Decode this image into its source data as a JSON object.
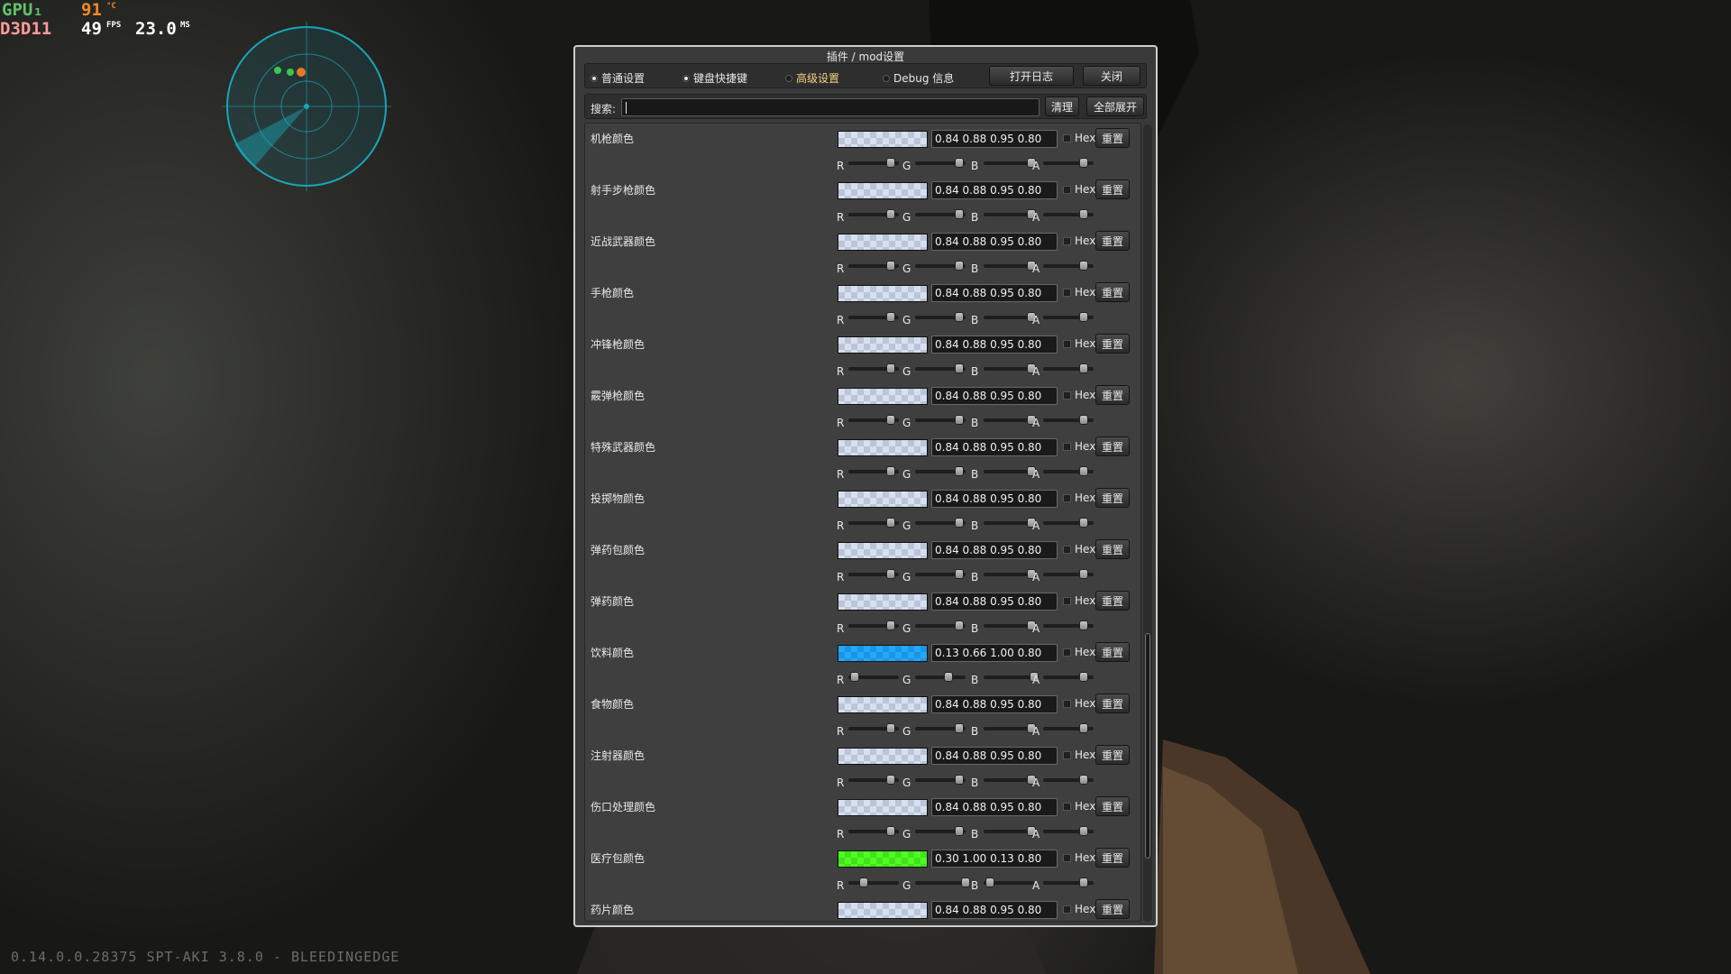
{
  "hud": {
    "gpu_label": "GPU₁",
    "gpu_temp": "91",
    "gpu_temp_unit": "°C",
    "api": "D3D11",
    "fps": "49",
    "fps_unit": "FPS",
    "frametime": "23.0",
    "frametime_unit": "MS"
  },
  "version": "0.14.0.0.28375 SPT-AKI 3.8.0 - BLEEDINGEDGE",
  "window": {
    "title": "插件 / mod设置",
    "tabs": [
      {
        "label": "普通设置",
        "selected": true
      },
      {
        "label": "键盘快捷键",
        "selected": true
      },
      {
        "label": "高级设置",
        "selected": false
      },
      {
        "label": "Debug 信息",
        "selected": false
      }
    ],
    "open_log_label": "打开日志",
    "close_label": "关闭",
    "search_label": "搜索:",
    "search_value": "",
    "clear_label": "清理",
    "expand_all_label": "全部展开",
    "hex_label": "Hex",
    "reset_label": "重置",
    "channel_labels": [
      "R",
      "G",
      "B",
      "A"
    ],
    "rows": [
      {
        "label": "机枪颜色",
        "value": "0.84 0.88 0.95 0.80",
        "rgba": [
          0.84,
          0.88,
          0.95,
          0.8
        ]
      },
      {
        "label": "射手步枪颜色",
        "value": "0.84 0.88 0.95 0.80",
        "rgba": [
          0.84,
          0.88,
          0.95,
          0.8
        ]
      },
      {
        "label": "近战武器颜色",
        "value": "0.84 0.88 0.95 0.80",
        "rgba": [
          0.84,
          0.88,
          0.95,
          0.8
        ]
      },
      {
        "label": "手枪颜色",
        "value": "0.84 0.88 0.95 0.80",
        "rgba": [
          0.84,
          0.88,
          0.95,
          0.8
        ]
      },
      {
        "label": "冲锋枪颜色",
        "value": "0.84 0.88 0.95 0.80",
        "rgba": [
          0.84,
          0.88,
          0.95,
          0.8
        ]
      },
      {
        "label": "霰弹枪颜色",
        "value": "0.84 0.88 0.95 0.80",
        "rgba": [
          0.84,
          0.88,
          0.95,
          0.8
        ]
      },
      {
        "label": "特殊武器颜色",
        "value": "0.84 0.88 0.95 0.80",
        "rgba": [
          0.84,
          0.88,
          0.95,
          0.8
        ]
      },
      {
        "label": "投掷物颜色",
        "value": "0.84 0.88 0.95 0.80",
        "rgba": [
          0.84,
          0.88,
          0.95,
          0.8
        ]
      },
      {
        "label": "弹药包颜色",
        "value": "0.84 0.88 0.95 0.80",
        "rgba": [
          0.84,
          0.88,
          0.95,
          0.8
        ]
      },
      {
        "label": "弹药颜色",
        "value": "0.84 0.88 0.95 0.80",
        "rgba": [
          0.84,
          0.88,
          0.95,
          0.8
        ]
      },
      {
        "label": "饮料颜色",
        "value": "0.13 0.66 1.00 0.80",
        "rgba": [
          0.13,
          0.66,
          1.0,
          0.8
        ]
      },
      {
        "label": "食物颜色",
        "value": "0.84 0.88 0.95 0.80",
        "rgba": [
          0.84,
          0.88,
          0.95,
          0.8
        ]
      },
      {
        "label": "注射器颜色",
        "value": "0.84 0.88 0.95 0.80",
        "rgba": [
          0.84,
          0.88,
          0.95,
          0.8
        ]
      },
      {
        "label": "伤口处理颜色",
        "value": "0.84 0.88 0.95 0.80",
        "rgba": [
          0.84,
          0.88,
          0.95,
          0.8
        ]
      },
      {
        "label": "医疗包颜色",
        "value": "0.30 1.00 0.13 0.80",
        "rgba": [
          0.3,
          1.0,
          0.13,
          0.8
        ]
      },
      {
        "label": "药片颜色",
        "value": "0.84 0.88 0.95 0.80",
        "rgba": [
          0.84,
          0.88,
          0.95,
          0.8
        ]
      }
    ]
  },
  "colors": {
    "radar": "#18a6b8",
    "hud_green": "#5fc36a",
    "hud_orange": "#f08a24"
  }
}
